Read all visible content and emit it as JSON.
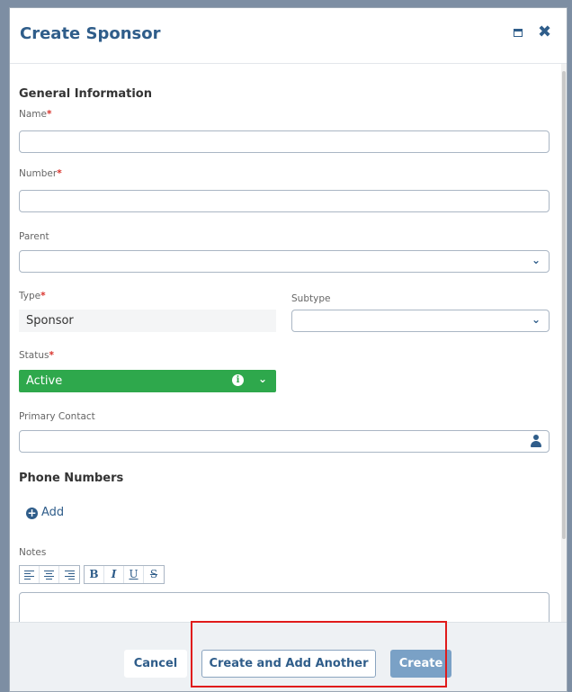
{
  "dialog": {
    "title": "Create Sponsor",
    "maximize_icon": "maximize-icon",
    "close_icon": "close-icon"
  },
  "general": {
    "section_title": "General Information",
    "name_label": "Name",
    "name_value": "",
    "number_label": "Number",
    "number_value": "",
    "parent_label": "Parent",
    "parent_value": "",
    "type_label": "Type",
    "type_value": "Sponsor",
    "subtype_label": "Subtype",
    "subtype_value": "",
    "status_label": "Status",
    "status_value": "Active",
    "status_color": "#2ea84c",
    "primary_contact_label": "Primary Contact",
    "primary_contact_value": "",
    "required_marker": "*"
  },
  "phone": {
    "section_title": "Phone Numbers",
    "add_label": "Add"
  },
  "notes": {
    "label": "Notes",
    "toolbar": [
      "align-left-icon",
      "align-center-icon",
      "align-right-icon",
      "B",
      "I",
      "U",
      "S"
    ]
  },
  "footer": {
    "cancel_label": "Cancel",
    "create_another_label": "Create and Add Another",
    "create_label": "Create"
  }
}
